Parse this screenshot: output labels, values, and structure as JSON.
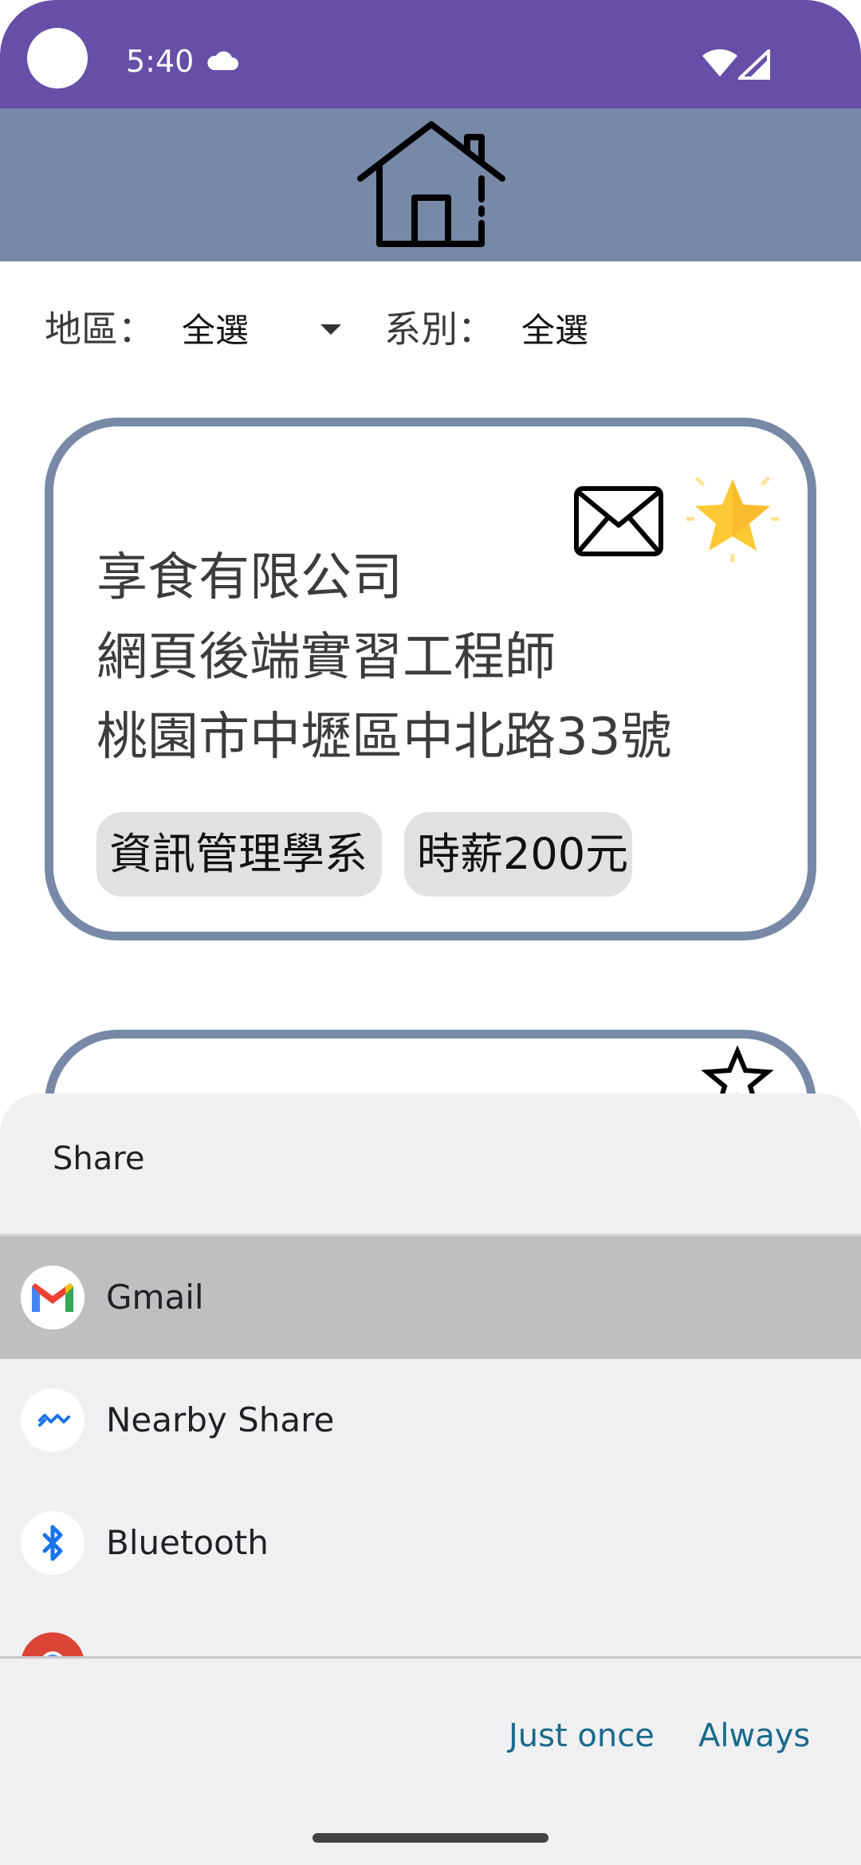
{
  "status_bar": {
    "time": "5:40"
  },
  "filters": {
    "region_label": "地區：",
    "region_value": "全選",
    "dept_label": "系別：",
    "dept_value": "全選"
  },
  "cards": [
    {
      "company": "享食有限公司",
      "position": "網頁後端實習工程師",
      "address": "桃園市中壢區中北路33號",
      "tags": [
        "資訊管理學系",
        "時薪200元"
      ]
    }
  ],
  "share_sheet": {
    "title": "Share",
    "apps": [
      {
        "label": "Gmail",
        "icon": "gmail-icon",
        "selected": true
      },
      {
        "label": "Nearby Share",
        "icon": "nearby-share-icon",
        "selected": false
      },
      {
        "label": "Bluetooth",
        "icon": "bluetooth-icon",
        "selected": false
      }
    ],
    "just_once": "Just once",
    "always": "Always"
  },
  "colors": {
    "status_bar": "#674ea7",
    "header": "#7789a7",
    "card_border": "#7789a7",
    "tag_bg": "#e1e1df",
    "sheet_bg": "#f0f0f2",
    "selected_row": "#bfbfc1",
    "action_text": "#1a6a8c"
  }
}
